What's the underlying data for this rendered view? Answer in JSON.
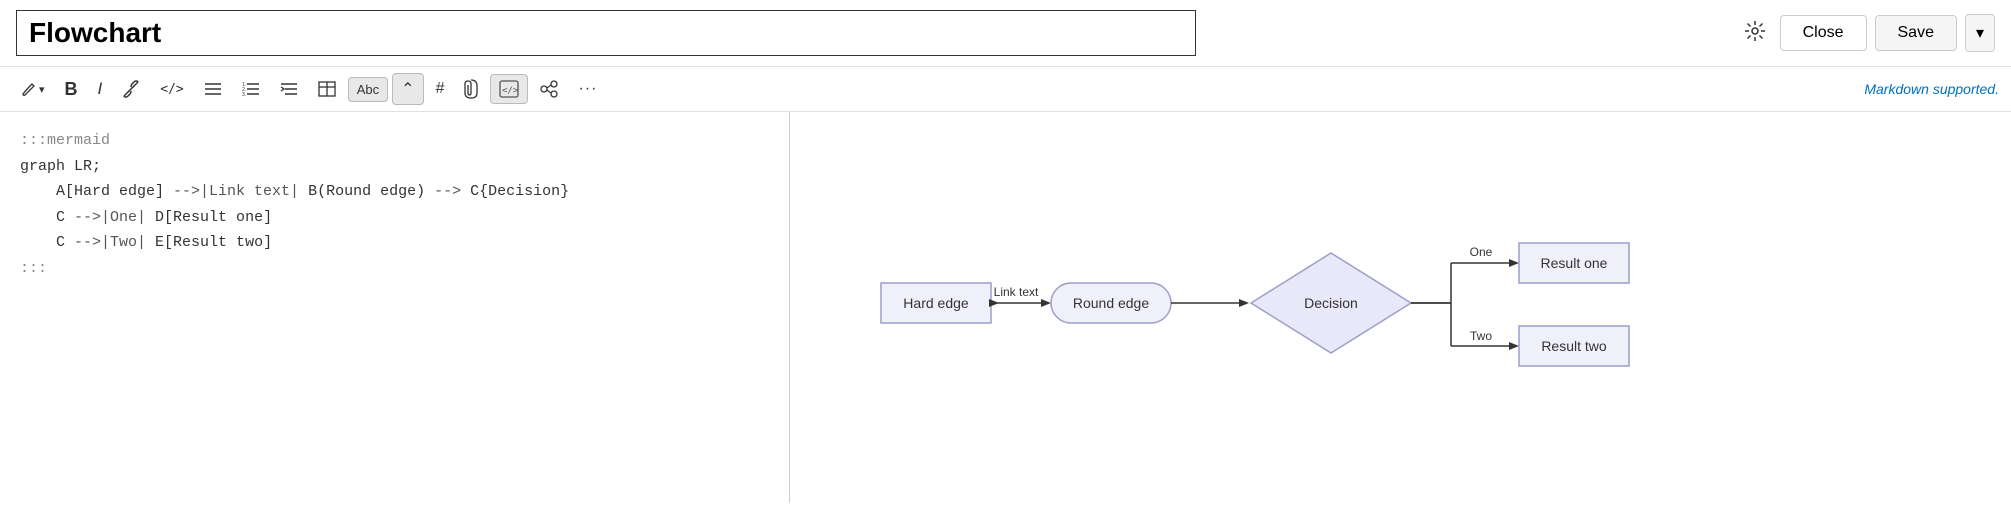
{
  "header": {
    "title": "Flowchart",
    "close_label": "Close",
    "save_label": "Save",
    "dropdown_icon": "▾",
    "settings_icon": "⚙"
  },
  "toolbar": {
    "brush_label": "🖌",
    "bold_label": "B",
    "italic_label": "I",
    "link_label": "🔗",
    "code_label": "</>",
    "list_label": "≡",
    "ordered_list_label": "≣",
    "indent_label": "⇥",
    "table_label": "⊞",
    "text_label": "Abc",
    "arrow_label": "⌃",
    "hash_label": "#",
    "attach_label": "📎",
    "snippet_label": "⟨/⟩",
    "diagram_label": "⊙",
    "more_label": "···",
    "markdown_link": "Markdown supported."
  },
  "editor": {
    "lines": [
      ":::mermaid",
      "graph LR;",
      "    A[Hard edge] -->|Link text| B(Round edge) --> C{Decision}",
      "    C -->|One| D[Result one]",
      "    C -->|Two| E[Result two]",
      ":::"
    ]
  },
  "flowchart": {
    "nodes": {
      "hard_edge": "Hard edge",
      "link_text": "Link text",
      "round_edge": "Round edge",
      "decision": "Decision",
      "one": "One",
      "two": "Two",
      "result_one": "Result one",
      "result_two": "Result two"
    }
  }
}
